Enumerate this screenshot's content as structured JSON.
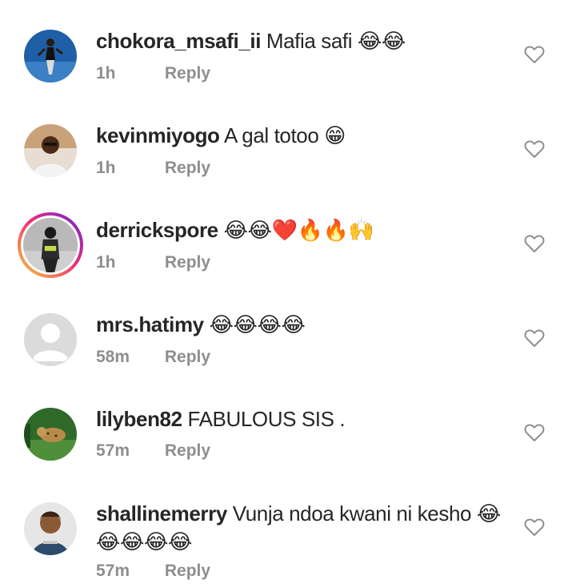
{
  "comments": [
    {
      "username": "chokora_msafi_ii",
      "text": "Mafia safi",
      "emoji": "😂😂",
      "time": "1h",
      "reply_label": "Reply"
    },
    {
      "username": "kevinmiyogo",
      "text": "A gal totoo",
      "emoji": "😁",
      "time": "1h",
      "reply_label": "Reply"
    },
    {
      "username": "derrickspore",
      "text": "",
      "emoji": "😂😂❤️🔥🔥🙌",
      "time": "1h",
      "reply_label": "Reply"
    },
    {
      "username": "mrs.hatimy",
      "text": "",
      "emoji": "😂😂😂😂",
      "time": "58m",
      "reply_label": "Reply"
    },
    {
      "username": "lilyben82",
      "text": "FABULOUS SIS .",
      "emoji": "",
      "time": "57m",
      "reply_label": "Reply"
    },
    {
      "username": "shallinemerry",
      "text": "Vunja ndoa kwani ni kesho",
      "emoji": "😂",
      "emoji_line2": "😂😂😂😂",
      "time": "57m",
      "reply_label": "Reply"
    }
  ],
  "icons": {
    "like": "heart-outline-icon"
  },
  "colors": {
    "text": "#262626",
    "meta": "#8e8e8e",
    "heart_stroke": "#8e8e8e"
  }
}
